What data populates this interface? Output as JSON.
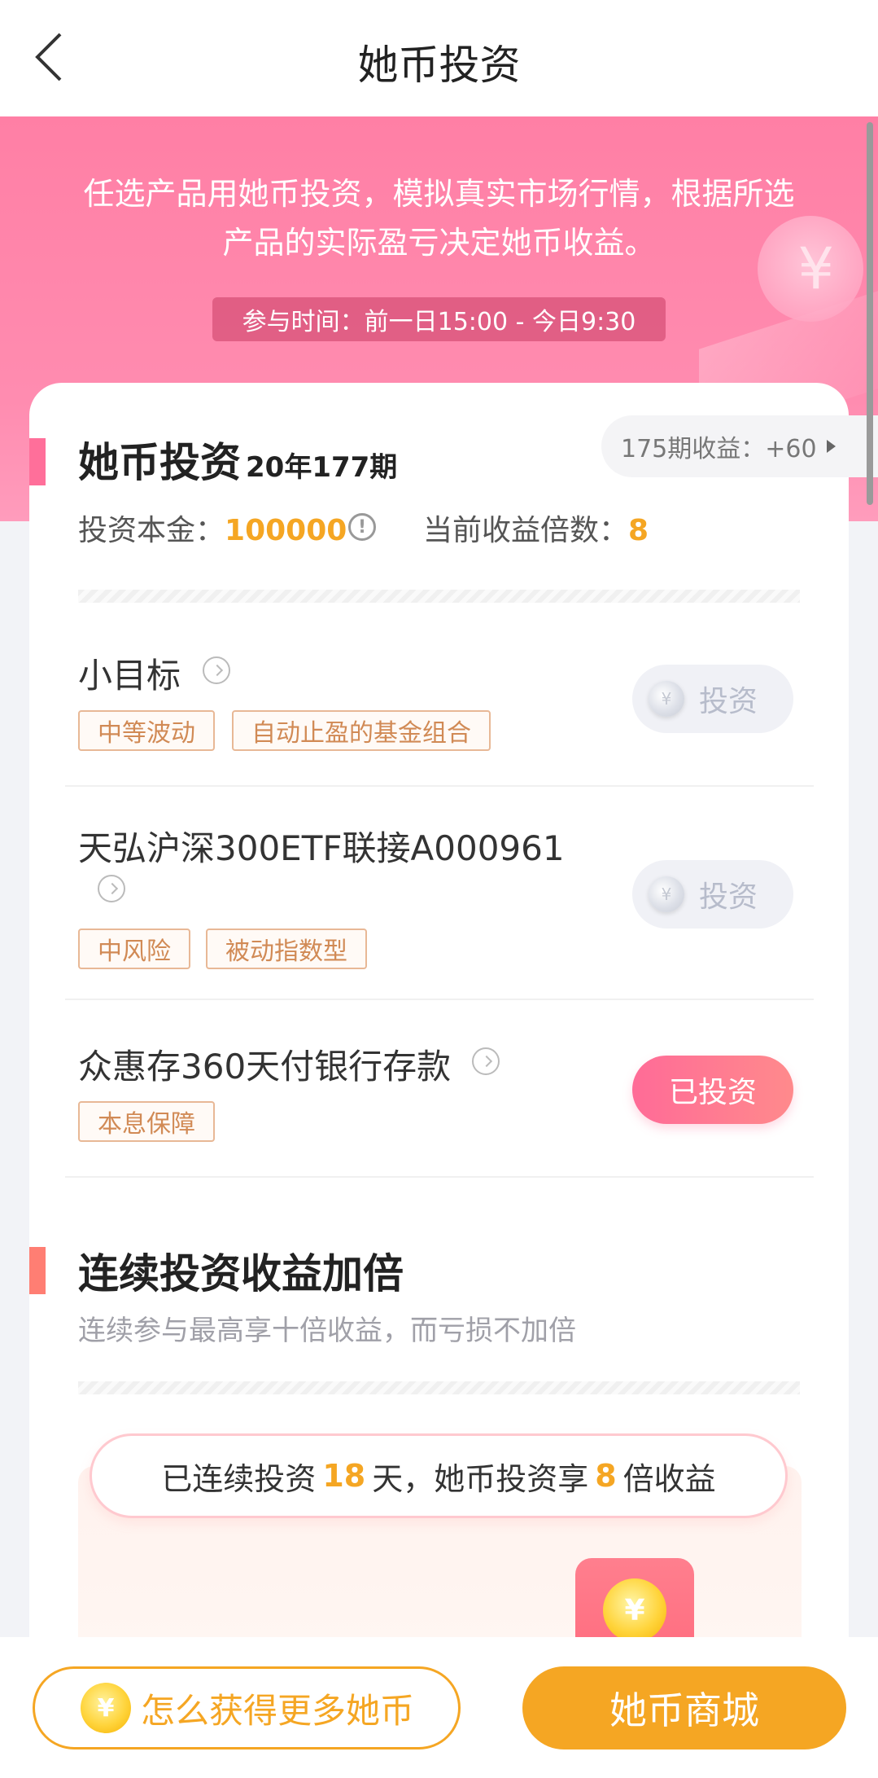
{
  "nav": {
    "title": "她币投资",
    "back_icon": "chevron-left-icon"
  },
  "banner": {
    "description": "任选产品用她币投资，模拟真实市场行情，根据所选产品的实际盈亏决定她币收益。",
    "time_text": "参与时间：前一日15:00 - 今日9:30",
    "deco_symbol": "¥"
  },
  "invest_section": {
    "title": "她币投资",
    "period": "20年177期",
    "profit_pill": "175期收益：+60",
    "principal_label": "投资本金：",
    "principal_value": "100000",
    "multiplier_label": "当前收益倍数：",
    "multiplier_value": "8"
  },
  "products": [
    {
      "name": "小目标",
      "tags": [
        "中等波动",
        "自动止盈的基金组合"
      ],
      "button": "投资",
      "coin_symbol": "¥",
      "state": "disabled"
    },
    {
      "name": "天弘沪深300ETF联接A000961",
      "tags": [
        "中风险",
        "被动指数型"
      ],
      "button": "投资",
      "coin_symbol": "¥",
      "state": "disabled"
    },
    {
      "name": "众惠存360天付银行存款",
      "tags": [
        "本息保障"
      ],
      "button": "已投资",
      "state": "invested"
    }
  ],
  "streak_section": {
    "title": "连续投资收益加倍",
    "subtitle": "连续参与最高享十倍收益，而亏损不加倍",
    "pill_prefix": "已连续投资",
    "days": "18",
    "pill_middle": "天，她币投资享",
    "multiplier": "8",
    "pill_suffix": "倍收益",
    "coin_symbol": "¥"
  },
  "bottom": {
    "how_label": "怎么获得更多她币",
    "how_coin": "¥",
    "mall_label": "她币商城"
  },
  "colors": {
    "accent_pink": "#ff6f9a",
    "accent_orange": "#f5a623",
    "banner_pink": "#ff85aa"
  }
}
